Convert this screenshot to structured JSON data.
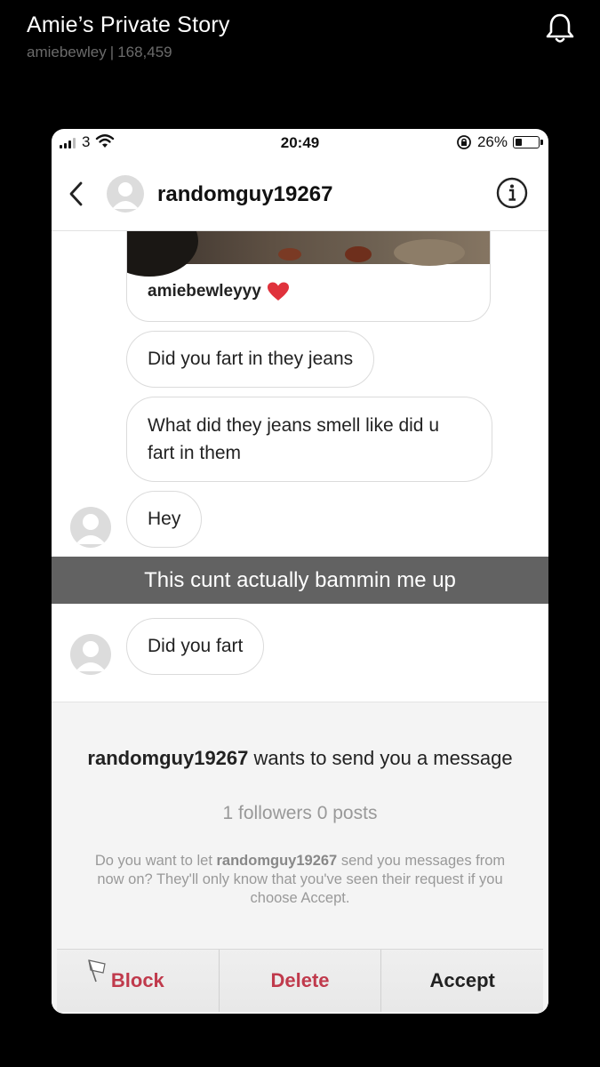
{
  "story": {
    "title": "Amie’s Private Story",
    "username": "amiebewley",
    "separator": "|",
    "view_count": "168,459"
  },
  "status_bar": {
    "carrier": "3",
    "time": "20:49",
    "battery_percent": "26%",
    "battery_level": 0.26,
    "signal_bars": 3
  },
  "chat_header": {
    "username": "randomguy19267"
  },
  "shared_post": {
    "caption": "amiebewleyyy"
  },
  "messages": [
    {
      "text": "Did you fart in they jeans"
    },
    {
      "text": "What did they jeans smell like did u fart in them"
    },
    {
      "text": "Hey"
    },
    {
      "text": "Did you fart"
    }
  ],
  "snap_caption": "This cunt actually bammin me up",
  "request": {
    "username": "randomguy19267",
    "wants_text": "wants to send you a message",
    "stats": "1 followers 0 posts",
    "desc_prefix": "Do you want to let",
    "desc_username": "randomguy19267",
    "desc_suffix": "send you messages from now on? They'll only know that you've seen their request if you choose Accept."
  },
  "actions": {
    "block": "Block",
    "delete": "Delete",
    "accept": "Accept"
  },
  "colors": {
    "destructive": "#c03a4c",
    "caption_bar": "#5a5a5a"
  }
}
